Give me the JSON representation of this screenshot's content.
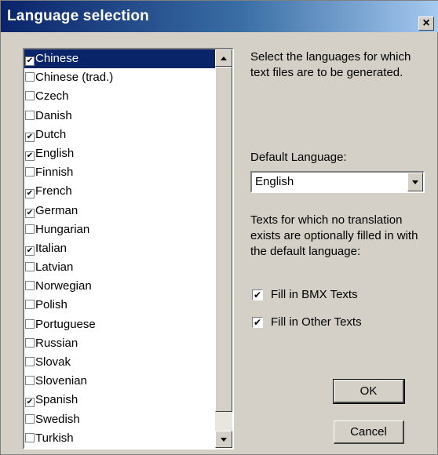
{
  "window": {
    "title": "Language selection",
    "close_label": "×"
  },
  "languages": [
    {
      "label": "Chinese",
      "checked": true,
      "selected": true
    },
    {
      "label": "Chinese (trad.)",
      "checked": false,
      "selected": false
    },
    {
      "label": "Czech",
      "checked": false,
      "selected": false
    },
    {
      "label": "Danish",
      "checked": false,
      "selected": false
    },
    {
      "label": "Dutch",
      "checked": true,
      "selected": false
    },
    {
      "label": "English",
      "checked": true,
      "selected": false
    },
    {
      "label": "Finnish",
      "checked": false,
      "selected": false
    },
    {
      "label": "French",
      "checked": true,
      "selected": false
    },
    {
      "label": "German",
      "checked": true,
      "selected": false
    },
    {
      "label": "Hungarian",
      "checked": false,
      "selected": false
    },
    {
      "label": "Italian",
      "checked": true,
      "selected": false
    },
    {
      "label": "Latvian",
      "checked": false,
      "selected": false
    },
    {
      "label": "Norwegian",
      "checked": false,
      "selected": false
    },
    {
      "label": "Polish",
      "checked": false,
      "selected": false
    },
    {
      "label": "Portuguese",
      "checked": false,
      "selected": false
    },
    {
      "label": "Russian",
      "checked": false,
      "selected": false
    },
    {
      "label": "Slovak",
      "checked": false,
      "selected": false
    },
    {
      "label": "Slovenian",
      "checked": false,
      "selected": false
    },
    {
      "label": "Spanish",
      "checked": true,
      "selected": false
    },
    {
      "label": "Swedish",
      "checked": false,
      "selected": false
    },
    {
      "label": "Turkish",
      "checked": false,
      "selected": false
    }
  ],
  "description": "Select the languages for which text files are to be generated.",
  "default_language": {
    "label": "Default Language:",
    "value": "English"
  },
  "fill_note": "Texts for which no translation exists are optionally filled in with the default language:",
  "options": {
    "fill_bmx": {
      "label": "Fill in BMX Texts",
      "checked": true
    },
    "fill_other": {
      "label": "Fill in Other Texts",
      "checked": true
    }
  },
  "buttons": {
    "ok": "OK",
    "cancel": "Cancel"
  },
  "colors": {
    "titlebar_start": "#0a246a",
    "titlebar_end": "#a6caf0",
    "face": "#d4d0c8",
    "selection": "#0a246a"
  }
}
